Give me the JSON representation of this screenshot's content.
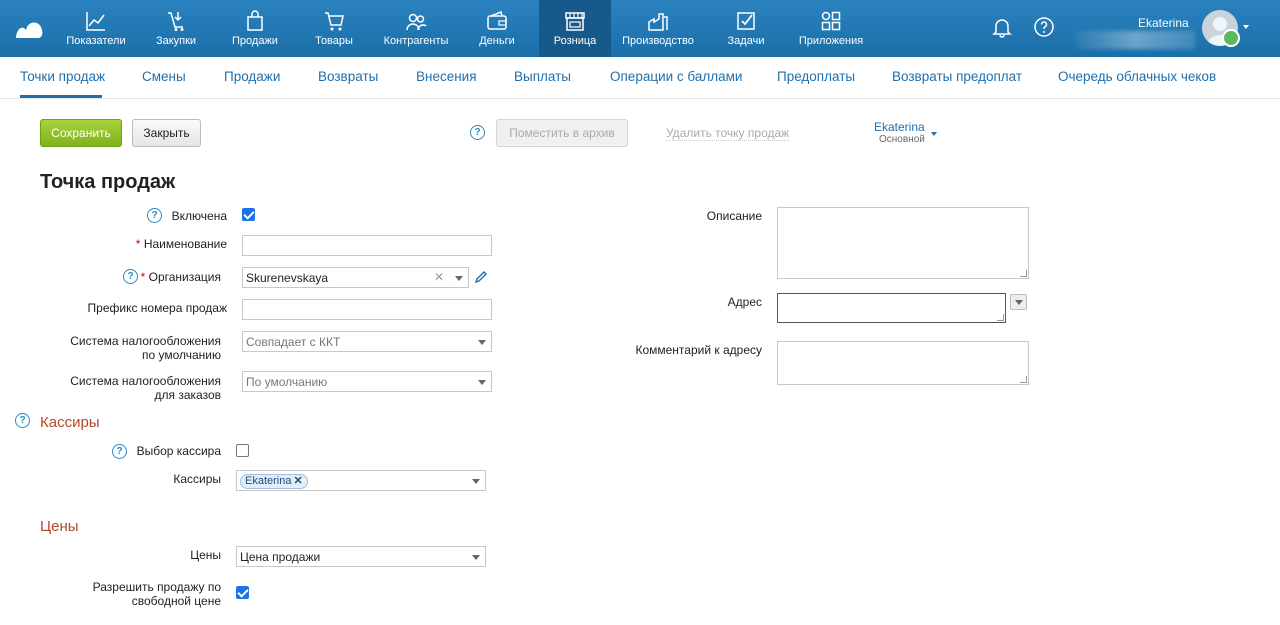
{
  "topbar": {
    "nav": [
      {
        "label": "Показатели",
        "icon": "chart-line-icon"
      },
      {
        "label": "Закупки",
        "icon": "cart-arrow-icon"
      },
      {
        "label": "Продажи",
        "icon": "shopping-bag-icon"
      },
      {
        "label": "Товары",
        "icon": "shopping-cart-icon"
      },
      {
        "label": "Контрагенты",
        "icon": "people-icon"
      },
      {
        "label": "Деньги",
        "icon": "wallet-icon"
      },
      {
        "label": "Розница",
        "icon": "store-icon",
        "active": true
      },
      {
        "label": "Производство",
        "icon": "factory-icon"
      },
      {
        "label": "Задачи",
        "icon": "task-check-icon"
      },
      {
        "label": "Приложения",
        "icon": "apps-grid-icon"
      }
    ],
    "user_name": "Ekaterina"
  },
  "subnav": {
    "items": [
      "Точки продаж",
      "Смены",
      "Продажи",
      "Возвраты",
      "Внесения",
      "Выплаты",
      "Операции с баллами",
      "Предоплаты",
      "Возвраты предоплат",
      "Очередь облачных чеков"
    ]
  },
  "toolbar": {
    "save": "Сохранить",
    "close": "Закрыть",
    "archive": "Поместить в архив",
    "delete": "Удалить точку продаж",
    "owner": "Ekaterina",
    "owner_role": "Основной",
    "help": "?"
  },
  "form": {
    "title": "Точка продаж",
    "enabled_label": "Включена",
    "name_label": "Наименование",
    "org_label": "Организация",
    "org_value": "Skurenevskaya",
    "prefix_label": "Префикс номера продаж",
    "tax_default_label_1": "Система налогообложения",
    "tax_default_label_2": "по умолчанию",
    "tax_default_value": "Совпадает с ККТ",
    "tax_orders_label_1": "Система налогообложения",
    "tax_orders_label_2": "для заказов",
    "tax_orders_value": "По умолчанию",
    "description_label": "Описание",
    "address_label": "Адрес",
    "address_comment_label": "Комментарий к адресу",
    "required_mark": "*"
  },
  "cashiers": {
    "title": "Кассиры",
    "choose_label": "Выбор кассира",
    "cashiers_label": "Кассиры",
    "tag": "Ekaterina",
    "tag_remove": "✕"
  },
  "prices": {
    "title": "Цены",
    "price_label": "Цены",
    "price_value": "Цена продажи",
    "free_price_label_1": "Разрешить продажу по",
    "free_price_label_2": "свободной цене"
  },
  "colors": {
    "topbar": "#1f78b4",
    "active_nav": "#16598a",
    "link": "#1f6fad",
    "save": "#8cc022",
    "section": "#b4472a"
  }
}
